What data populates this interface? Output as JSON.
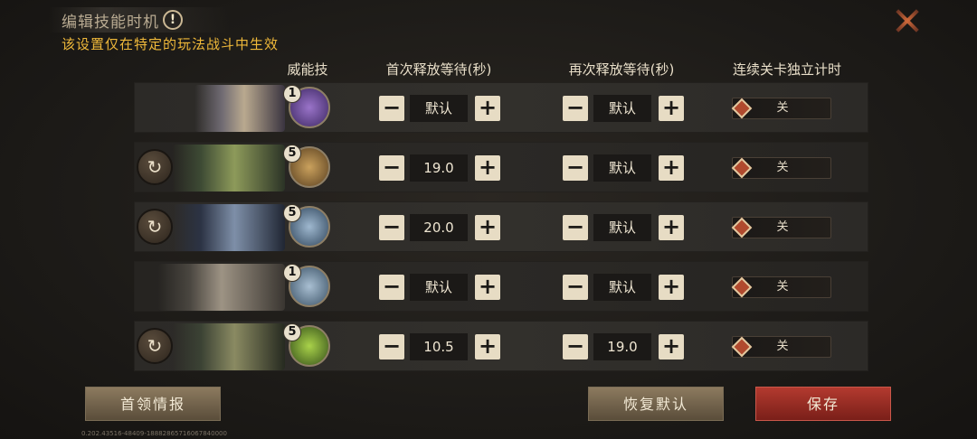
{
  "header": {
    "title": "编辑技能时机",
    "info_icon": "!",
    "subtitle": "该设置仅在特定的玩法战斗中生效"
  },
  "columns": {
    "skill": "威能技",
    "first_wait": "首次释放等待(秒)",
    "next_wait": "再次释放等待(秒)",
    "independent_timer": "连续关卡独立计时"
  },
  "rows": [
    {
      "has_reset": false,
      "skill_level": "1",
      "first_wait": "默认",
      "next_wait": "默认",
      "toggle": "关",
      "skill_color": "#5b3e86"
    },
    {
      "has_reset": true,
      "skill_level": "5",
      "first_wait": "19.0",
      "next_wait": "默认",
      "toggle": "关",
      "skill_color": "#8a6a3a"
    },
    {
      "has_reset": true,
      "skill_level": "5",
      "first_wait": "20.0",
      "next_wait": "默认",
      "toggle": "关",
      "skill_color": "#4c6a86"
    },
    {
      "has_reset": false,
      "skill_level": "1",
      "first_wait": "默认",
      "next_wait": "默认",
      "toggle": "关",
      "skill_color": "#4f6f8a"
    },
    {
      "has_reset": true,
      "skill_level": "5",
      "first_wait": "10.5",
      "next_wait": "19.0",
      "toggle": "关",
      "skill_color": "#6f8a2e"
    }
  ],
  "icons": {
    "reset": "rotate-arrow-icon",
    "minus": "minus-icon",
    "plus": "plus-icon",
    "close": "close-icon"
  },
  "footer": {
    "intel_button": "首领情报",
    "restore_button": "恢复默认",
    "save_button": "保存",
    "version": "0.202.43516-48409-18882865716067840000"
  }
}
